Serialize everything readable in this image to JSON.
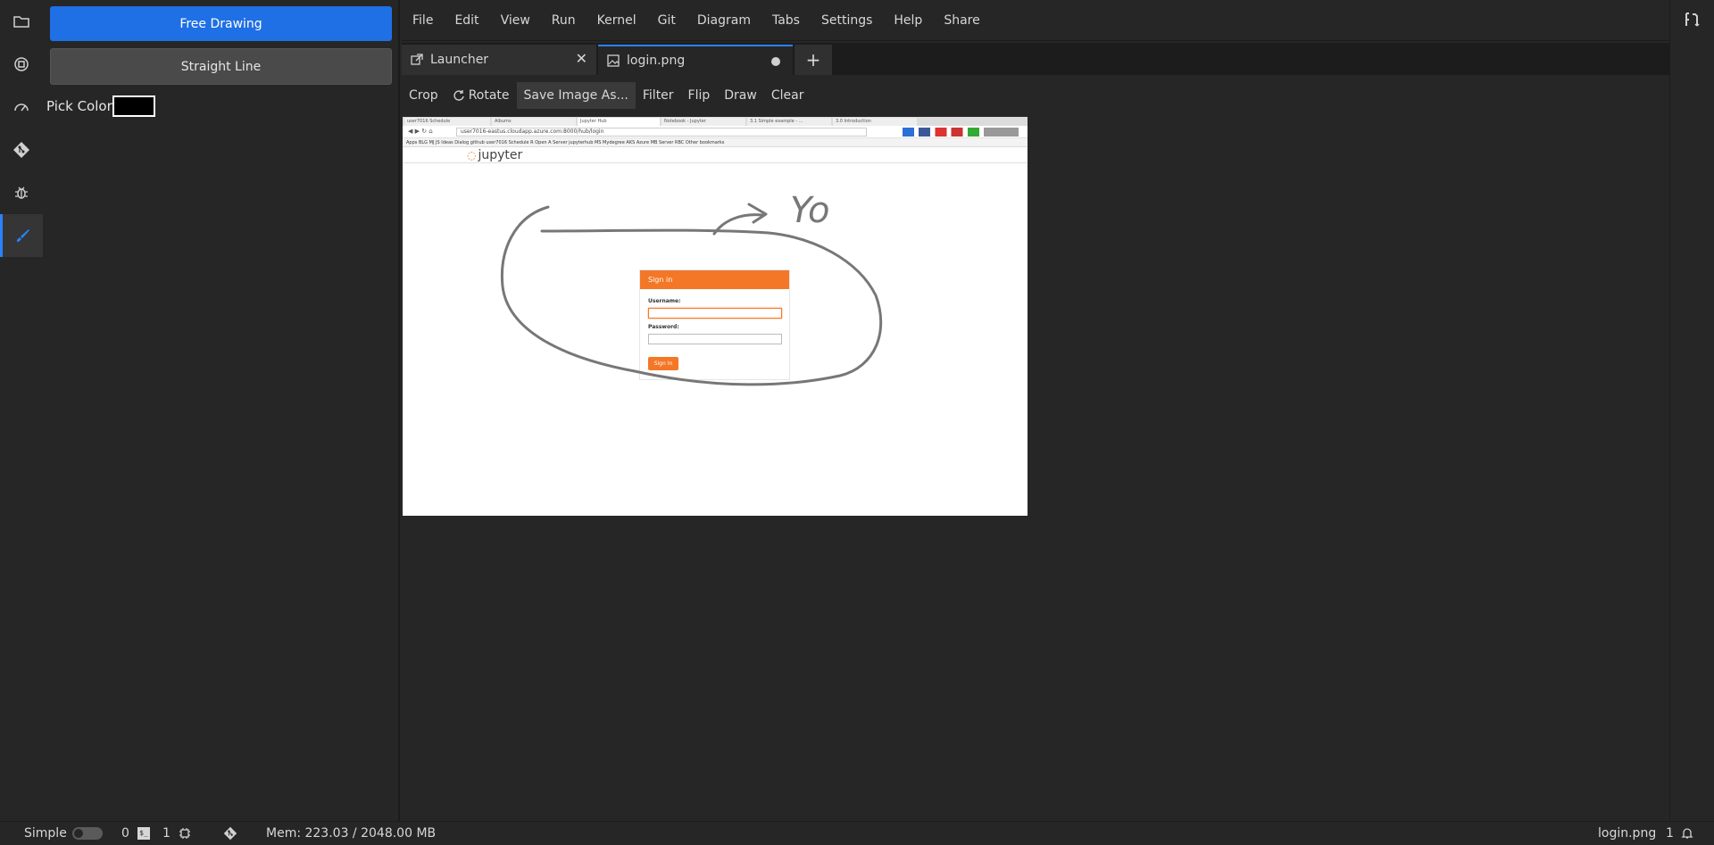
{
  "sidebar": {
    "free_drawing": "Free Drawing",
    "straight_line": "Straight Line",
    "pick_color": "Pick Color",
    "color_value": "#000000"
  },
  "menu": [
    "File",
    "Edit",
    "View",
    "Run",
    "Kernel",
    "Git",
    "Diagram",
    "Tabs",
    "Settings",
    "Help",
    "Share"
  ],
  "tabs": [
    {
      "label": "Launcher",
      "icon": "external-link-icon"
    },
    {
      "label": "login.png",
      "icon": "image-icon",
      "modified": true
    }
  ],
  "toolbar": {
    "crop": "Crop",
    "rotate": "Rotate",
    "save_as": "Save Image As...",
    "filter": "Filter",
    "flip": "Flip",
    "draw": "Draw",
    "clear": "Clear"
  },
  "image": {
    "browser_tabs": [
      "user7016 Schedule",
      "Albums",
      "Jupyter Hub",
      "Notebook - Jupyter",
      "3.1 Simple example - ...",
      "3.0 Introduction"
    ],
    "url": "user7016-eastus.cloudapp.azure.com:8000/hub/login",
    "bookmarks": "Apps  BLG  MJ  JS  Ideas  Dialog  github  user7016 Schedule  R Open  A Server  jupyterhub  MS  Mydegree  AKS  Azure  MB  Server  RBC  Other bookmarks",
    "logo_text": "jupyter",
    "signin_title": "Sign in",
    "username_label": "Username:",
    "password_label": "Password:",
    "signin_button": "Sign In",
    "annotation": "Yo"
  },
  "status": {
    "mode": "Simple",
    "kernels": "0",
    "terminals": "1",
    "memory": "Mem: 223.03 / 2048.00 MB",
    "filename": "login.png",
    "notifications": "1"
  }
}
